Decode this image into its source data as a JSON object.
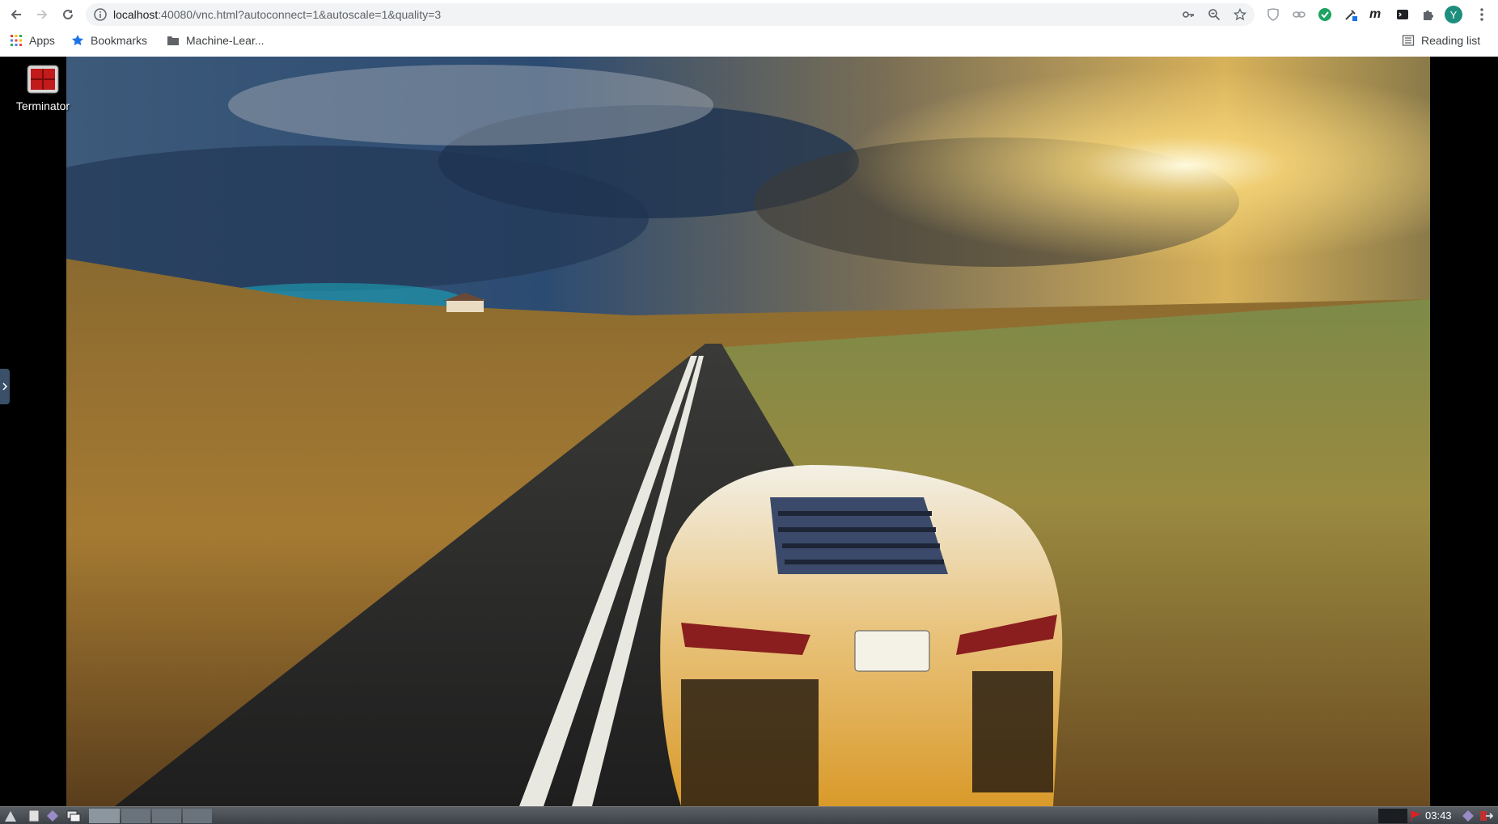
{
  "browser": {
    "url_host": "localhost",
    "url_rest": ":40080/vnc.html?autoconnect=1&autoscale=1&quality=3",
    "avatar_letter": "Y",
    "bookmarks": [
      {
        "label": "Apps",
        "icon": "apps-grid-icon"
      },
      {
        "label": "Bookmarks",
        "icon": "star-icon"
      },
      {
        "label": "Machine-Lear...",
        "icon": "folder-icon"
      }
    ],
    "reading_list": "Reading list"
  },
  "desktop": {
    "icon_label": "Terminator",
    "clock": "03:43"
  },
  "colors": {
    "chrome_bg": "#ffffff",
    "omnibox_bg": "#f1f3f4",
    "avatar": "#1e8e7e",
    "taskbar": "#4a5056"
  }
}
